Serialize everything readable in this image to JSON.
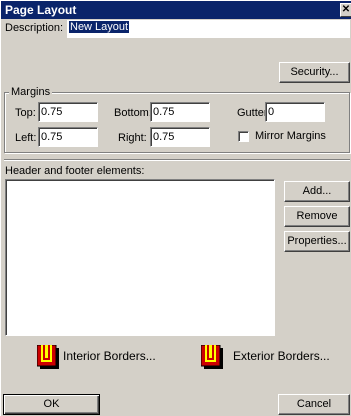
{
  "dialog": {
    "title": "Page Layout",
    "close_glyph": "✕"
  },
  "description": {
    "label": "Description:",
    "value": "New Layout"
  },
  "security_button": "Security...",
  "margins": {
    "group_label": "Margins",
    "top_label": "Top:",
    "top_value": "0.75",
    "bottom_label": "Bottom:",
    "bottom_value": "0.75",
    "gutter_label": "Gutter:",
    "gutter_value": "0",
    "left_label": "Left:",
    "left_value": "0.75",
    "right_label": "Right:",
    "right_value": "0.75",
    "mirror_label": "Mirror Margins",
    "mirror_checked": false
  },
  "header_footer": {
    "label": "Header and footer elements:",
    "items": [],
    "add_button": "Add...",
    "remove_button": "Remove",
    "properties_button": "Properties..."
  },
  "borders": {
    "interior_label": "Interior Borders...",
    "exterior_label": "Exterior Borders...",
    "icon_colors": {
      "red": "#cc0000",
      "yellow": "#ffff00",
      "dark": "#000000"
    }
  },
  "footer": {
    "ok_button": "OK",
    "cancel_button": "Cancel"
  }
}
